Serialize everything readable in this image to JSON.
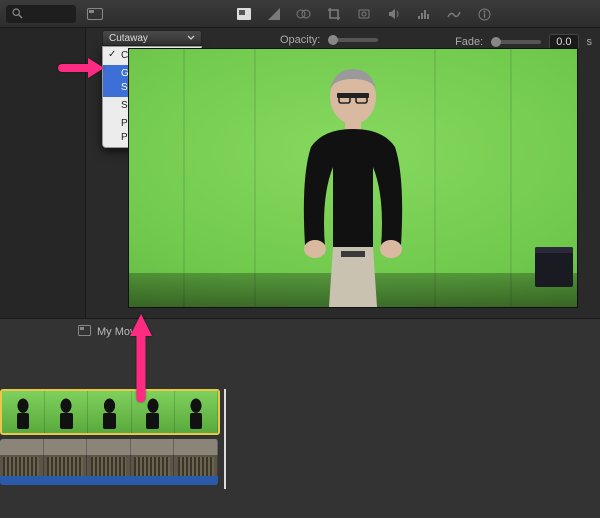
{
  "toolbar": {
    "icons": [
      "overlay-settings",
      "color-balance",
      "color-correction",
      "crop",
      "stabilize",
      "audio",
      "audio-effects",
      "video-effects",
      "info"
    ]
  },
  "overlay_controls": {
    "dropdown_label": "Cutaway",
    "menu": {
      "checked": "Cutaway",
      "highlighted": "Green/Blue Screen",
      "items": [
        "Cutaway",
        "Green/Blue Screen",
        "Side by Side",
        "Picture in Picture"
      ]
    },
    "opacity_label": "Opacity:",
    "fade_label": "Fade:",
    "fade_value": "0.0",
    "fade_unit": "s"
  },
  "project": {
    "name": "My Movie"
  },
  "colors": {
    "highlight": "#3d6fd6",
    "arrow": "#ff2b82",
    "green": "#6fc84c",
    "clip_border": "#e8c84a"
  }
}
